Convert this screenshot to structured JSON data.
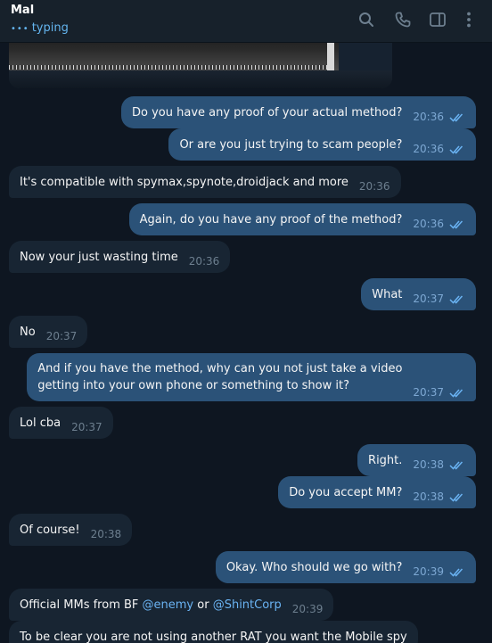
{
  "header": {
    "name": "Mal",
    "status": "typing",
    "icons": [
      "search-icon",
      "phone-icon",
      "sidebar-icon",
      "more-icon"
    ]
  },
  "messages": [
    {
      "dir": "out",
      "text": "Do you have any proof of your actual method?",
      "time": "20:36"
    },
    {
      "dir": "out",
      "text": "Or are you just trying to scam people?",
      "time": "20:36"
    },
    {
      "dir": "in",
      "text": "It's compatible with spymax,spynote,droidjack and more",
      "time": "20:36"
    },
    {
      "dir": "out",
      "text": "Again, do you have any proof of the method?",
      "time": "20:36"
    },
    {
      "dir": "in",
      "text": "Now your just wasting time",
      "time": "20:36"
    },
    {
      "dir": "out",
      "text": "What",
      "time": "20:37"
    },
    {
      "dir": "in",
      "text": "No",
      "time": "20:37"
    },
    {
      "dir": "out",
      "line1": "And if you have the method, why can you not just take a video",
      "line2": "getting into your own phone or something to show it?",
      "time": "20:37"
    },
    {
      "dir": "in",
      "text": "Lol cba",
      "time": "20:37"
    },
    {
      "dir": "out",
      "text": "Right.",
      "time": "20:38"
    },
    {
      "dir": "out",
      "text": "Do you accept MM?",
      "time": "20:38"
    },
    {
      "dir": "in",
      "text": "Of course!",
      "time": "20:38"
    },
    {
      "dir": "out",
      "text": "Okay. Who should we go with?",
      "time": "20:39"
    },
    {
      "dir": "in",
      "pre": "Official MMs from BF ",
      "link1": "@enemy",
      "mid": " or ",
      "link2": "@ShintCorp",
      "time": "20:39"
    },
    {
      "dir": "in",
      "text": "To be clear you are not using another RAT you want the Mobile spy"
    }
  ],
  "colors": {
    "background": "#0e1621",
    "header": "#17212b",
    "outgoing_bubble": "#2b5278",
    "incoming_bubble": "#182533",
    "accent": "#64b5ef",
    "link": "#6ab3f3"
  }
}
